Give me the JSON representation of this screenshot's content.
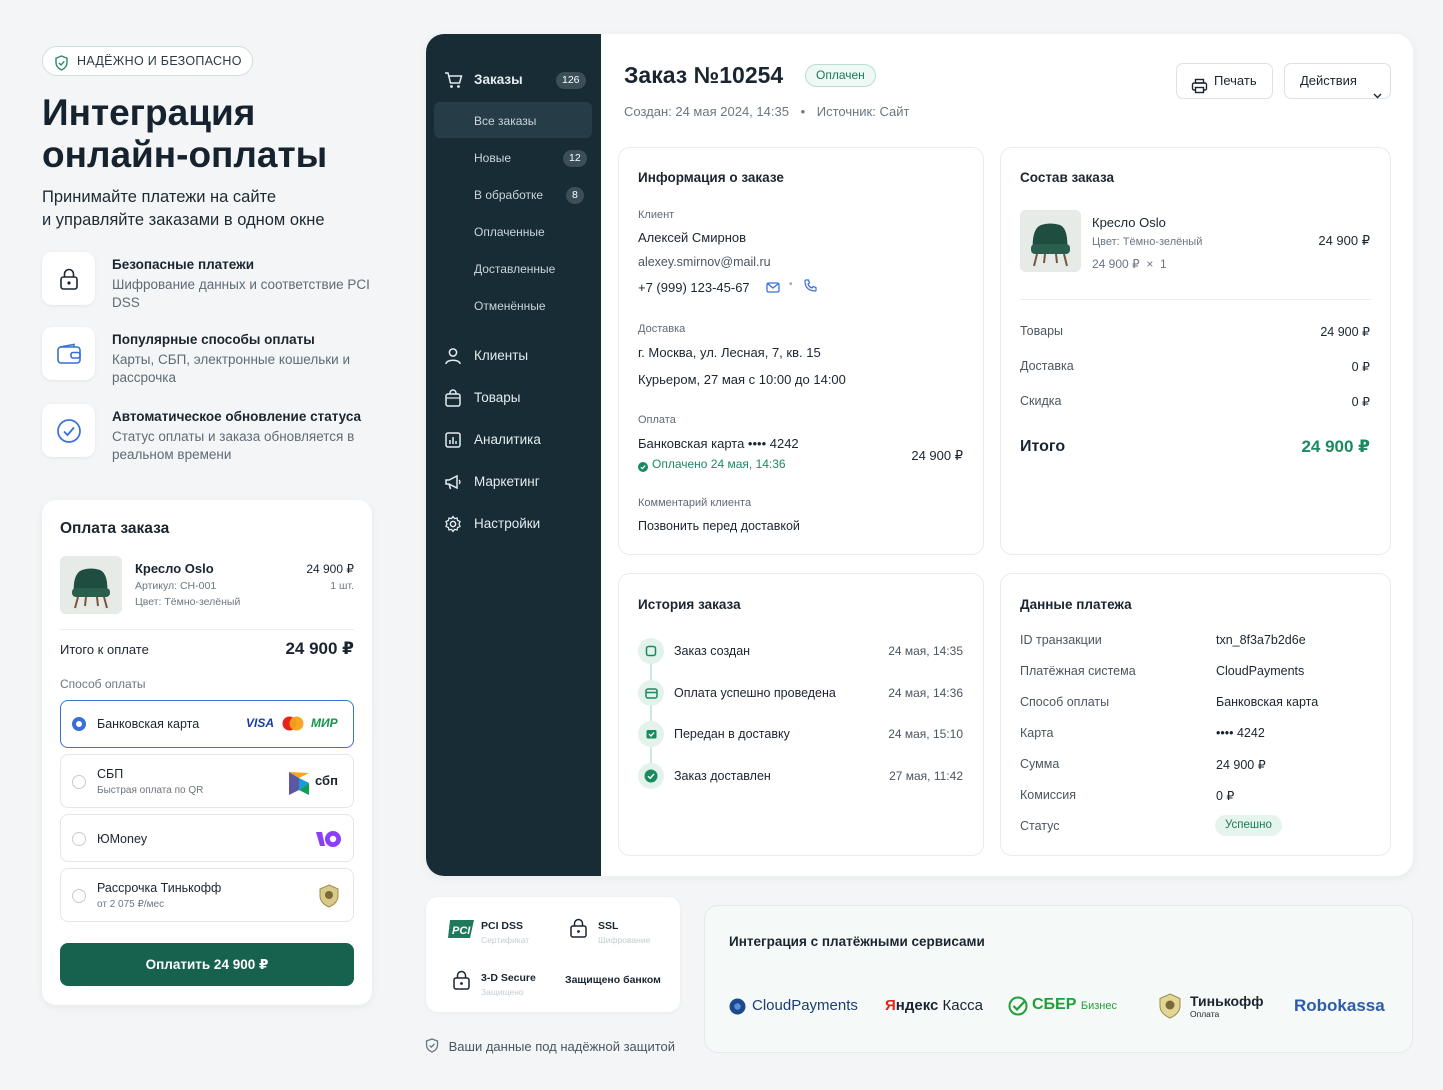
{
  "hero": {
    "badge": "НАДЁЖНО И БЕЗОПАСНО",
    "title_line1": "Интеграция",
    "title_line2": "онлайн-оплаты",
    "subtitle_line1": "Принимайте платежи на сайте",
    "subtitle_line2": "и управляйте заказами в одном окне"
  },
  "features": [
    {
      "title": "Безопасные платежи",
      "desc": "Шифрование данных и соответствие PCI DSS",
      "icon": "lock-icon"
    },
    {
      "title": "Популярные способы оплаты",
      "desc": "Карты, СБП, электронные кошельки и рассрочка",
      "icon": "wallet-icon"
    },
    {
      "title": "Автоматическое обновление статуса",
      "desc": "Статус оплаты и заказа обновляется в реальном времени",
      "icon": "check-circle-icon"
    }
  ],
  "payment_widget": {
    "title": "Оплата заказа",
    "product_name": "Кресло Oslo",
    "product_article": "Артикул: CH-001",
    "product_color": "Цвет: Тёмно-зелёный",
    "product_price": "24 900 ₽",
    "product_qty": "1 шт.",
    "total_label": "Итого к оплате",
    "total_value": "24 900 ₽",
    "method_label": "Способ оплаты",
    "options": [
      {
        "name": "Банковская карта",
        "sub": "",
        "selected": true
      },
      {
        "name": "СБП",
        "sub": "Быстрая оплата по QR",
        "selected": false
      },
      {
        "name": "ЮMoney",
        "sub": "",
        "selected": false
      },
      {
        "name": "Рассрочка Тинькофф",
        "sub": "от 2 075 ₽/мес",
        "selected": false
      }
    ],
    "card_brands": {
      "visa": "VISA",
      "mir": "МИР"
    },
    "sbp_logo": "сбп",
    "pay_button": "Оплатить 24 900 ₽",
    "accent": "#17624f"
  },
  "sidebar": {
    "orders_label": "Заказы",
    "orders_count": "126",
    "sub_items": [
      {
        "label": "Все заказы",
        "count": "",
        "active": true
      },
      {
        "label": "Новые",
        "count": "12"
      },
      {
        "label": "В обработке",
        "count": "8"
      },
      {
        "label": "Оплаченные",
        "count": ""
      },
      {
        "label": "Доставленные",
        "count": ""
      },
      {
        "label": "Отменённые",
        "count": ""
      }
    ],
    "items": [
      {
        "label": "Клиенты",
        "icon": "user-icon"
      },
      {
        "label": "Товары",
        "icon": "bag-icon"
      },
      {
        "label": "Аналитика",
        "icon": "chart-icon"
      },
      {
        "label": "Маркетинг",
        "icon": "megaphone-icon"
      },
      {
        "label": "Настройки",
        "icon": "gear-icon"
      }
    ]
  },
  "order": {
    "title": "Заказ №10254",
    "status": "Оплачен",
    "created": "Создан: 24 мая 2024, 14:35",
    "source": "Источник: Сайт",
    "print_button": "Печать",
    "actions_button": "Действия"
  },
  "info": {
    "title": "Информация о заказе",
    "client_label": "Клиент",
    "client_name": "Алексей Смирнов",
    "client_email": "alexey.smirnov@mail.ru",
    "client_phone": "+7 (999) 123-45-67",
    "delivery_label": "Доставка",
    "delivery_address": "г. Москва, ул. Лесная, 7, кв. 15",
    "delivery_time": "Курьером, 27 мая с 10:00 до 14:00",
    "payment_label": "Оплата",
    "payment_method": "Банковская карта •••• 4242",
    "payment_status": "Оплачено 24 мая, 14:36",
    "payment_amount": "24 900 ₽",
    "comment_label": "Комментарий клиента",
    "comment": "Позвонить перед доставкой"
  },
  "composition": {
    "title": "Состав заказа",
    "item_name": "Кресло Oslo",
    "item_color": "Цвет: Тёмно-зелёный",
    "item_qty": "24 900 ₽  ×  1",
    "item_price": "24 900 ₽",
    "rows": [
      {
        "label": "Товары",
        "value": "24 900 ₽"
      },
      {
        "label": "Доставка",
        "value": "0 ₽"
      },
      {
        "label": "Скидка",
        "value": "0 ₽"
      }
    ],
    "total_label": "Итого",
    "total_value": "24 900 ₽"
  },
  "history": {
    "title": "История заказа",
    "events": [
      {
        "label": "Заказ создан",
        "time": "24 мая, 14:35"
      },
      {
        "label": "Оплата успешно проведена",
        "time": "24 мая, 14:36"
      },
      {
        "label": "Передан в доставку",
        "time": "24 мая, 15:10"
      },
      {
        "label": "Заказ доставлен",
        "time": "27 мая, 11:42"
      }
    ]
  },
  "payment_data": {
    "title": "Данные платежа",
    "rows": [
      {
        "label": "ID транзакции",
        "value": "txn_8f3a7b2d6e"
      },
      {
        "label": "Платёжная система",
        "value": "CloudPayments"
      },
      {
        "label": "Способ оплаты",
        "value": "Банковская карта"
      },
      {
        "label": "Карта",
        "value": "•••• 4242"
      },
      {
        "label": "Сумма",
        "value": "24 900 ₽"
      },
      {
        "label": "Комиссия",
        "value": "0 ₽"
      }
    ],
    "status_label": "Статус",
    "status_value": "Успешно"
  },
  "security": {
    "pci_badge": "PCI",
    "pci": "PCI DSS",
    "pci_sub": "Сертификат",
    "ssl": "SSL",
    "ssl_sub": "Шифрование",
    "tds": "3-D Secure",
    "tds_sub": "Защищено",
    "bank": "Защищено банком",
    "protected_note": "Ваши данные под надёжной защитой"
  },
  "integrations": {
    "title": "Интеграция с платёжными сервисами",
    "cloudpayments": "CloudPayments",
    "yandex_red": "Я",
    "yandex_rest": "ндекс",
    "yandex_kassa": "Касса",
    "sber": "СБЕР",
    "sber_sub": "Бизнес",
    "tinkoff": "Тинькофф",
    "tinkoff_sub": "Оплата",
    "robokassa": "Robokassa"
  }
}
